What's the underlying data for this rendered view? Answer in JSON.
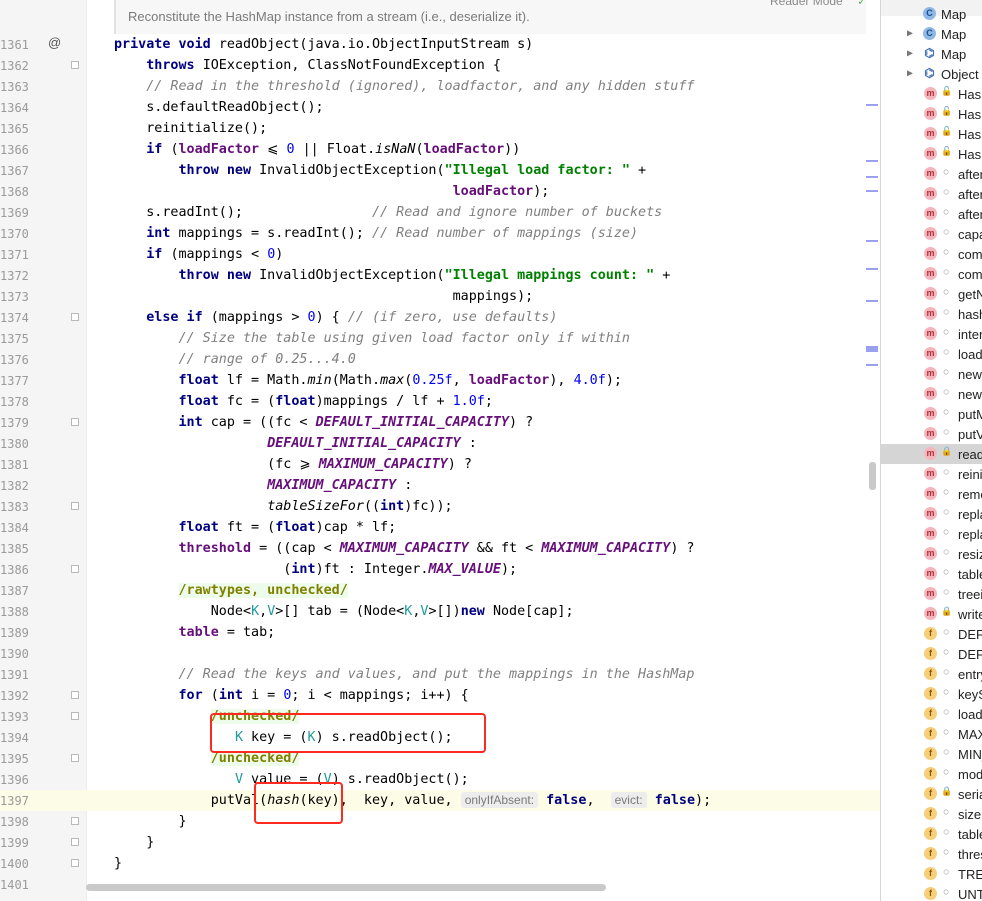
{
  "doc_hint": "Reconstitute the HashMap instance from a stream (i.e., deserialize it).",
  "reader_mode": "Reader Mode",
  "code_lines": [
    {
      "n": "1361",
      "tokens": [
        [
          "kw",
          "private void "
        ],
        [
          "",
          "readObject(java.io.ObjectInputStream s)"
        ]
      ]
    },
    {
      "n": "1362",
      "tokens": [
        [
          "",
          "    "
        ],
        [
          "kw",
          "throws "
        ],
        [
          "",
          "IOException, ClassNotFoundException {"
        ]
      ]
    },
    {
      "n": "1363",
      "tokens": [
        [
          "",
          "    "
        ],
        [
          "cm",
          "// Read in the threshold (ignored), loadfactor, and any hidden stuff"
        ]
      ]
    },
    {
      "n": "1364",
      "tokens": [
        [
          "",
          "    s.defaultReadObject();"
        ]
      ]
    },
    {
      "n": "1365",
      "tokens": [
        [
          "",
          "    reinitialize();"
        ]
      ]
    },
    {
      "n": "1366",
      "tokens": [
        [
          "",
          "    "
        ],
        [
          "kw",
          "if "
        ],
        [
          "",
          "("
        ],
        [
          "fd",
          "loadFactor"
        ],
        [
          "",
          " ⩽ "
        ],
        [
          "nm",
          "0"
        ],
        [
          "",
          " || Float."
        ],
        [
          "it",
          "isNaN"
        ],
        [
          "",
          "("
        ],
        [
          "fd",
          "loadFactor"
        ],
        [
          "",
          "))"
        ]
      ]
    },
    {
      "n": "1367",
      "tokens": [
        [
          "",
          "        "
        ],
        [
          "kw",
          "throw new "
        ],
        [
          "",
          "InvalidObjectException("
        ],
        [
          "st",
          "\"Illegal load factor: \""
        ],
        [
          "",
          " +"
        ]
      ]
    },
    {
      "n": "1368",
      "tokens": [
        [
          "",
          "                                          "
        ],
        [
          "fd",
          "loadFactor"
        ],
        [
          "",
          ");"
        ]
      ]
    },
    {
      "n": "1369",
      "tokens": [
        [
          "",
          "    s.readInt();                "
        ],
        [
          "cm",
          "// Read and ignore number of buckets"
        ]
      ]
    },
    {
      "n": "1370",
      "tokens": [
        [
          "",
          "    "
        ],
        [
          "kw",
          "int "
        ],
        [
          "",
          "mappings = s.readInt(); "
        ],
        [
          "cm",
          "// Read number of mappings (size)"
        ]
      ]
    },
    {
      "n": "1371",
      "tokens": [
        [
          "",
          "    "
        ],
        [
          "kw",
          "if "
        ],
        [
          "",
          "(mappings < "
        ],
        [
          "nm",
          "0"
        ],
        [
          "",
          ")"
        ]
      ]
    },
    {
      "n": "1372",
      "tokens": [
        [
          "",
          "        "
        ],
        [
          "kw",
          "throw new "
        ],
        [
          "",
          "InvalidObjectException("
        ],
        [
          "st",
          "\"Illegal mappings count: \""
        ],
        [
          "",
          " +"
        ]
      ]
    },
    {
      "n": "1373",
      "tokens": [
        [
          "",
          "                                          mappings);"
        ]
      ]
    },
    {
      "n": "1374",
      "tokens": [
        [
          "",
          "    "
        ],
        [
          "kw",
          "else if "
        ],
        [
          "",
          "(mappings > "
        ],
        [
          "nm",
          "0"
        ],
        [
          "",
          ") { "
        ],
        [
          "cm",
          "// (if zero, use defaults)"
        ]
      ]
    },
    {
      "n": "1375",
      "tokens": [
        [
          "",
          "        "
        ],
        [
          "cm",
          "// Size the table using given load factor only if within"
        ]
      ]
    },
    {
      "n": "1376",
      "tokens": [
        [
          "",
          "        "
        ],
        [
          "cm",
          "// range of 0.25...4.0"
        ]
      ]
    },
    {
      "n": "1377",
      "tokens": [
        [
          "",
          "        "
        ],
        [
          "kw",
          "float "
        ],
        [
          "",
          "lf = Math."
        ],
        [
          "it",
          "min"
        ],
        [
          "",
          "(Math."
        ],
        [
          "it",
          "max"
        ],
        [
          "",
          "("
        ],
        [
          "nm",
          "0.25f"
        ],
        [
          "",
          ", "
        ],
        [
          "fd",
          "loadFactor"
        ],
        [
          "",
          "), "
        ],
        [
          "nm",
          "4.0f"
        ],
        [
          "",
          ");"
        ]
      ]
    },
    {
      "n": "1378",
      "tokens": [
        [
          "",
          "        "
        ],
        [
          "kw",
          "float "
        ],
        [
          "",
          "fc = ("
        ],
        [
          "kw",
          "float"
        ],
        [
          "",
          ")mappings / lf + "
        ],
        [
          "nm",
          "1.0f"
        ],
        [
          "",
          ";"
        ]
      ]
    },
    {
      "n": "1379",
      "tokens": [
        [
          "",
          "        "
        ],
        [
          "kw",
          "int "
        ],
        [
          "",
          "cap = ((fc < "
        ],
        [
          "sf",
          "DEFAULT_INITIAL_CAPACITY"
        ],
        [
          "",
          ") ?"
        ]
      ]
    },
    {
      "n": "1380",
      "tokens": [
        [
          "",
          "                   "
        ],
        [
          "sf",
          "DEFAULT_INITIAL_CAPACITY"
        ],
        [
          "",
          " :"
        ]
      ]
    },
    {
      "n": "1381",
      "tokens": [
        [
          "",
          "                   (fc ⩾ "
        ],
        [
          "sf",
          "MAXIMUM_CAPACITY"
        ],
        [
          "",
          ") ?"
        ]
      ]
    },
    {
      "n": "1382",
      "tokens": [
        [
          "",
          "                   "
        ],
        [
          "sf",
          "MAXIMUM_CAPACITY"
        ],
        [
          "",
          " :"
        ]
      ]
    },
    {
      "n": "1383",
      "tokens": [
        [
          "",
          "                   "
        ],
        [
          "it",
          "tableSizeFor"
        ],
        [
          "",
          "(("
        ],
        [
          "kw",
          "int"
        ],
        [
          "",
          ")fc));"
        ]
      ]
    },
    {
      "n": "1384",
      "tokens": [
        [
          "",
          "        "
        ],
        [
          "kw",
          "float "
        ],
        [
          "",
          "ft = ("
        ],
        [
          "kw",
          "float"
        ],
        [
          "",
          ")cap * lf;"
        ]
      ]
    },
    {
      "n": "1385",
      "tokens": [
        [
          "",
          "        "
        ],
        [
          "fd",
          "threshold"
        ],
        [
          "",
          " = ((cap < "
        ],
        [
          "sf",
          "MAXIMUM_CAPACITY"
        ],
        [
          "",
          " && ft < "
        ],
        [
          "sf",
          "MAXIMUM_CAPACITY"
        ],
        [
          "",
          ") ?"
        ]
      ]
    },
    {
      "n": "1386",
      "tokens": [
        [
          "",
          "                     ("
        ],
        [
          "kw",
          "int"
        ],
        [
          "",
          ")ft : Integer."
        ],
        [
          "sf",
          "MAX_VALUE"
        ],
        [
          "",
          ");"
        ]
      ]
    },
    {
      "n": "1387",
      "tokens": [
        [
          "",
          "        "
        ],
        [
          "sup",
          "/rawtypes, unchecked/"
        ]
      ]
    },
    {
      "n": "1388",
      "tokens": [
        [
          "",
          "            Node<"
        ],
        [
          "tp",
          "K"
        ],
        [
          "",
          ","
        ],
        [
          "tp",
          "V"
        ],
        [
          "",
          ">[] tab = (Node<"
        ],
        [
          "tp",
          "K"
        ],
        [
          "",
          ","
        ],
        [
          "tp",
          "V"
        ],
        [
          "",
          ">[])"
        ],
        [
          "kw",
          "new "
        ],
        [
          "",
          "Node[cap];"
        ]
      ]
    },
    {
      "n": "1389",
      "tokens": [
        [
          "",
          "        "
        ],
        [
          "fd",
          "table"
        ],
        [
          "",
          " = tab;"
        ]
      ]
    },
    {
      "n": "1390",
      "tokens": []
    },
    {
      "n": "1391",
      "tokens": [
        [
          "",
          "        "
        ],
        [
          "cm",
          "// Read the keys and values, and put the mappings in the HashMap"
        ]
      ]
    },
    {
      "n": "1392",
      "tokens": [
        [
          "",
          "        "
        ],
        [
          "kw",
          "for "
        ],
        [
          "",
          "("
        ],
        [
          "kw",
          "int "
        ],
        [
          "",
          "i = "
        ],
        [
          "nm",
          "0"
        ],
        [
          "",
          "; i < mappings; i++) {"
        ]
      ]
    },
    {
      "n": "1393",
      "tokens": [
        [
          "",
          "            "
        ],
        [
          "sup",
          "/unchecked/"
        ]
      ]
    },
    {
      "n": "1394",
      "tokens": [
        [
          "",
          "               "
        ],
        [
          "tp",
          "K"
        ],
        [
          "",
          " key = ("
        ],
        [
          "tp",
          "K"
        ],
        [
          "",
          ") s.readObject();"
        ]
      ]
    },
    {
      "n": "1395",
      "tokens": [
        [
          "",
          "            "
        ],
        [
          "sup",
          "/unchecked/"
        ]
      ]
    },
    {
      "n": "1396",
      "tokens": [
        [
          "",
          "               "
        ],
        [
          "tp",
          "V"
        ],
        [
          "",
          " value = ("
        ],
        [
          "tp",
          "V"
        ],
        [
          "",
          ") s.readObject();"
        ]
      ]
    },
    {
      "n": "1397",
      "tokens": [
        [
          "",
          "            putVal("
        ],
        [
          "it",
          "hash"
        ],
        [
          "",
          "(key),  key, value, "
        ],
        [
          "hint",
          "onlyIfAbsent:"
        ],
        [
          "",
          " "
        ],
        [
          "kw",
          "false"
        ],
        [
          "",
          ",  "
        ],
        [
          "hint",
          "evict:"
        ],
        [
          "",
          " "
        ],
        [
          "kw",
          "false"
        ],
        [
          "",
          ");"
        ]
      ]
    },
    {
      "n": "1398",
      "tokens": [
        [
          "",
          "        }"
        ]
      ]
    },
    {
      "n": "1399",
      "tokens": [
        [
          "",
          "    }"
        ]
      ]
    },
    {
      "n": "1400",
      "tokens": [
        [
          "",
          "}"
        ]
      ]
    },
    {
      "n": "1401",
      "tokens": []
    }
  ],
  "structure_tree": [
    {
      "icon": "c",
      "vis": "",
      "label": "Map",
      "arrow": "",
      "big": true
    },
    {
      "icon": "c",
      "vis": "",
      "label": "Map",
      "arrow": "▶",
      "big": true
    },
    {
      "icon": "h",
      "vis": "",
      "label": "Map",
      "arrow": "▶",
      "big": true
    },
    {
      "icon": "h",
      "vis": "",
      "label": "Object",
      "arrow": "▶",
      "big": true
    },
    {
      "icon": "m",
      "vis": "open",
      "label": "HashMap"
    },
    {
      "icon": "m",
      "vis": "open",
      "label": "HashMap"
    },
    {
      "icon": "m",
      "vis": "open",
      "label": "HashMap"
    },
    {
      "icon": "m",
      "vis": "open",
      "label": "HashMap"
    },
    {
      "icon": "m",
      "vis": "",
      "label": "afterNodeAccess"
    },
    {
      "icon": "m",
      "vis": "",
      "label": "afterNodeInsertion"
    },
    {
      "icon": "m",
      "vis": "",
      "label": "afterNodeRemoval"
    },
    {
      "icon": "m",
      "vis": "",
      "label": "capacity"
    },
    {
      "icon": "m",
      "vis": "",
      "label": "comparableClassFor"
    },
    {
      "icon": "m",
      "vis": "",
      "label": "compareComparables"
    },
    {
      "icon": "m",
      "vis": "",
      "label": "getNode"
    },
    {
      "icon": "m",
      "vis": "",
      "label": "hash"
    },
    {
      "icon": "m",
      "vis": "",
      "label": "internalWriteEntries"
    },
    {
      "icon": "m",
      "vis": "",
      "label": "loadFactor"
    },
    {
      "icon": "m",
      "vis": "",
      "label": "newNode"
    },
    {
      "icon": "m",
      "vis": "",
      "label": "newTreeNode"
    },
    {
      "icon": "m",
      "vis": "",
      "label": "putMapEntries"
    },
    {
      "icon": "m",
      "vis": "",
      "label": "putVal"
    },
    {
      "icon": "m",
      "vis": "lock",
      "label": "readObject",
      "selected": true
    },
    {
      "icon": "m",
      "vis": "",
      "label": "reinitialize"
    },
    {
      "icon": "m",
      "vis": "",
      "label": "removeNode"
    },
    {
      "icon": "m",
      "vis": "",
      "label": "replacementNode"
    },
    {
      "icon": "m",
      "vis": "",
      "label": "replacementTreeNode"
    },
    {
      "icon": "m",
      "vis": "",
      "label": "resize"
    },
    {
      "icon": "m",
      "vis": "",
      "label": "tableSizeFor"
    },
    {
      "icon": "m",
      "vis": "",
      "label": "treeifyBin"
    },
    {
      "icon": "m",
      "vis": "lock",
      "label": "writeObject"
    },
    {
      "icon": "f",
      "vis": "",
      "label": "DEFAULT_INITIAL_CAPACITY"
    },
    {
      "icon": "f",
      "vis": "",
      "label": "DEFAULT_LOAD_FACTOR"
    },
    {
      "icon": "f",
      "vis": "",
      "label": "entrySet"
    },
    {
      "icon": "f",
      "vis": "",
      "label": "keySet"
    },
    {
      "icon": "f",
      "vis": "",
      "label": "loadFactor"
    },
    {
      "icon": "f",
      "vis": "",
      "label": "MAXIMUM_CAPACITY"
    },
    {
      "icon": "f",
      "vis": "",
      "label": "MIN_TREEIFY_CAPACITY"
    },
    {
      "icon": "f",
      "vis": "",
      "label": "modCount"
    },
    {
      "icon": "f",
      "vis": "lock",
      "label": "serialVersionUID"
    },
    {
      "icon": "f",
      "vis": "",
      "label": "size"
    },
    {
      "icon": "f",
      "vis": "",
      "label": "table"
    },
    {
      "icon": "f",
      "vis": "",
      "label": "threshold"
    },
    {
      "icon": "f",
      "vis": "",
      "label": "TREEIFY_THRESHOLD"
    },
    {
      "icon": "f",
      "vis": "",
      "label": "UNTREEIFY_THRESHOLD"
    }
  ],
  "icon_glyphs": {
    "m": "m",
    "f": "f",
    "c": "C",
    "h": "⌬"
  },
  "colors": {
    "highlight_box": "#ff2a1f",
    "keyword": "#000080",
    "string": "#008000",
    "comment": "#808080",
    "constant": "#660e7a"
  }
}
